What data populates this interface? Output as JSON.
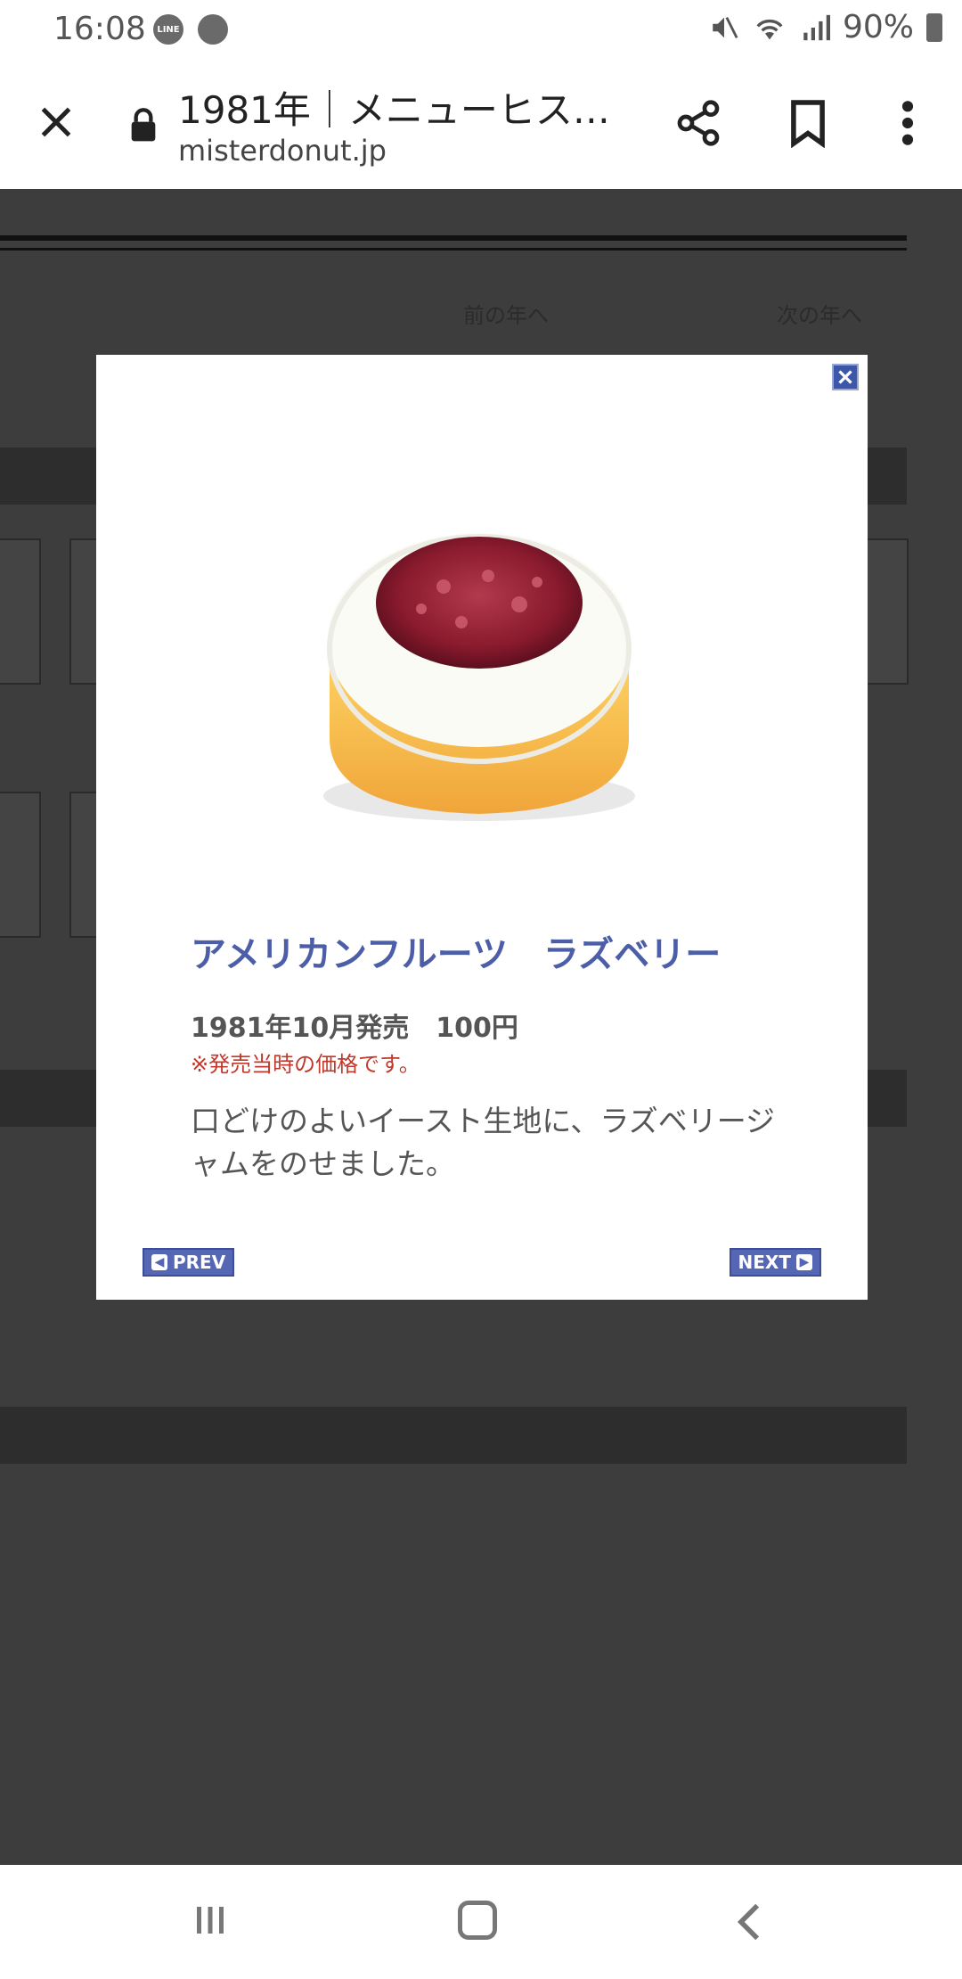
{
  "status_bar": {
    "time": "16:08",
    "apps": [
      "LINE",
      "Browser"
    ],
    "battery": "90%",
    "icons": [
      "mute-icon",
      "wifi-icon",
      "signal-icon",
      "battery-icon"
    ]
  },
  "browser": {
    "title": "1981年｜メニューヒス…",
    "url": "misterdonut.jp"
  },
  "background_page": {
    "prev_year_link": "前の年へ",
    "next_year_link": "次の年へ"
  },
  "modal": {
    "product_name": "アメリカンフルーツ　ラズベリー",
    "release_info": "1981年10月発売　100円",
    "price_note": "※発売当時の価格です。",
    "description": "口どけのよいイースト生地に、ラズベリージャムをのせました。",
    "prev_label": "PREV",
    "next_label": "NEXT"
  },
  "colors": {
    "accent_blue": "#4d5ea8",
    "note_red": "#c0392b"
  }
}
